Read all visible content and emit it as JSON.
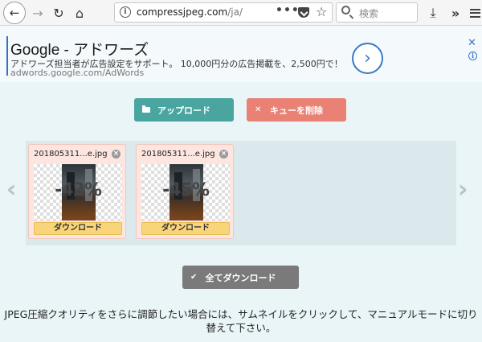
{
  "browser": {
    "url_host": "compressjpeg.com",
    "url_path": "/ja/",
    "search_placeholder": "検索",
    "icons": [
      "back-arrow-icon",
      "forward-arrow-icon",
      "reload-icon",
      "home-icon",
      "info-icon",
      "more-actions-icon",
      "pocket-icon",
      "bookmark-star-icon",
      "search-icon",
      "download-icon",
      "overflow-chevron-icon",
      "hamburger-menu-icon"
    ]
  },
  "ad": {
    "title": "Google - アドワーズ",
    "description": "アドワーズ担当者が広告設定をサポート。 10,000円分の広告掲載を、2,500円で！",
    "url": "adwords.google.com/AdWords",
    "close": "✕",
    "info": "i"
  },
  "actions": {
    "upload_label": "アップロード",
    "clear_label": "キューを削除",
    "download_all_label": "全てダウンロード"
  },
  "files": [
    {
      "name": "201805311...e.jpg",
      "reduction": "-42%",
      "download_label": "ダウンロード"
    },
    {
      "name": "201805311...e.jpg",
      "reduction": "-45%",
      "download_label": "ダウンロード"
    }
  ],
  "info_text": "JPEG圧縮クオリティをさらに調節したい場合には、サムネイルをクリックして、マニュアルモードに切り替えて下さい。",
  "colors": {
    "upload": "#4aa5a0",
    "clear": "#e98174",
    "download_all": "#7a7a7a",
    "download_card": "#f9d57a",
    "ad_link": "#3a78c9"
  }
}
